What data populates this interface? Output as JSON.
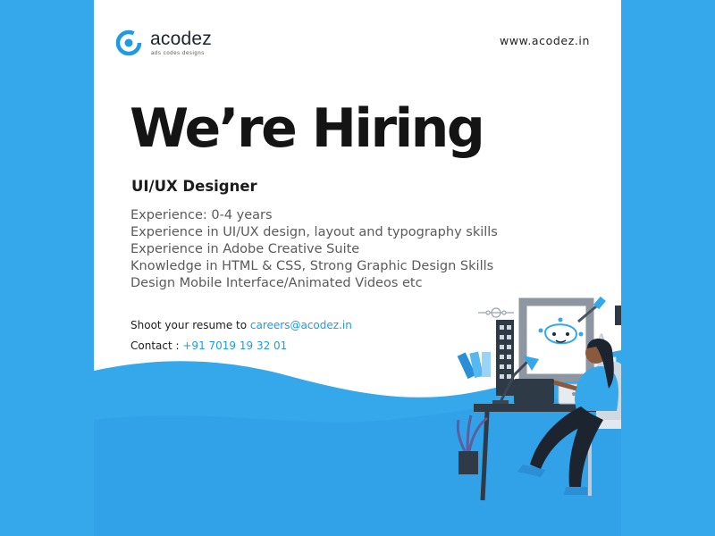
{
  "brand": {
    "name": "acodez",
    "tagline": "ads codes designs",
    "website": "www.acodez.in"
  },
  "headline": "We’re Hiring",
  "role": "UI/UX Designer",
  "requirements": [
    "Experience: 0-4 years",
    "Experience in UI/UX design, layout and typography skills",
    "Experience in Adobe Creative Suite",
    "Knowledge in HTML & CSS, Strong Graphic Design Skills",
    "Design Mobile Interface/Animated Videos etc"
  ],
  "resume": {
    "label": "Shoot your resume to",
    "email": "careers@acodez.in"
  },
  "contact": {
    "label": "Contact :",
    "phone": "+91 7019 19 32 01"
  },
  "colors": {
    "background": "#35a8ec",
    "card": "#ffffff",
    "accent": "#1e9be4",
    "headline": "#141414"
  }
}
